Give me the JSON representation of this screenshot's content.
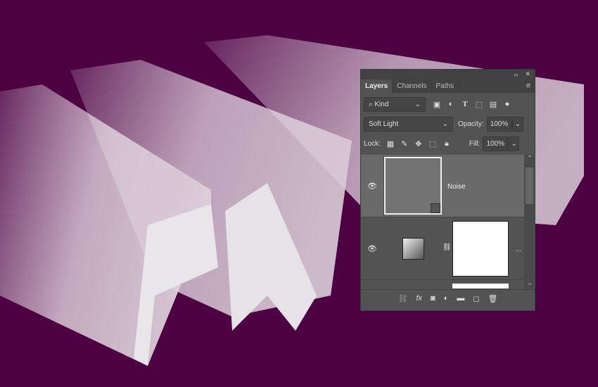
{
  "panel": {
    "collapse": "‹‹",
    "close": "✕",
    "menu": "≡",
    "tabs": [
      {
        "label": "Layers"
      },
      {
        "label": "Channels"
      },
      {
        "label": "Paths"
      }
    ],
    "filter": {
      "label": "Kind"
    },
    "blend_mode": "Soft Light",
    "opacity": {
      "label": "Opacity:",
      "value": "100%"
    },
    "lock": {
      "label": "Lock:"
    },
    "fill": {
      "label": "Fill:",
      "value": "100%"
    },
    "layers": [
      {
        "name": "Noise",
        "selected": true
      },
      {
        "name": "",
        "more": "..."
      }
    ]
  },
  "colors": {
    "background": "#4d0042",
    "panel": "#535353"
  }
}
